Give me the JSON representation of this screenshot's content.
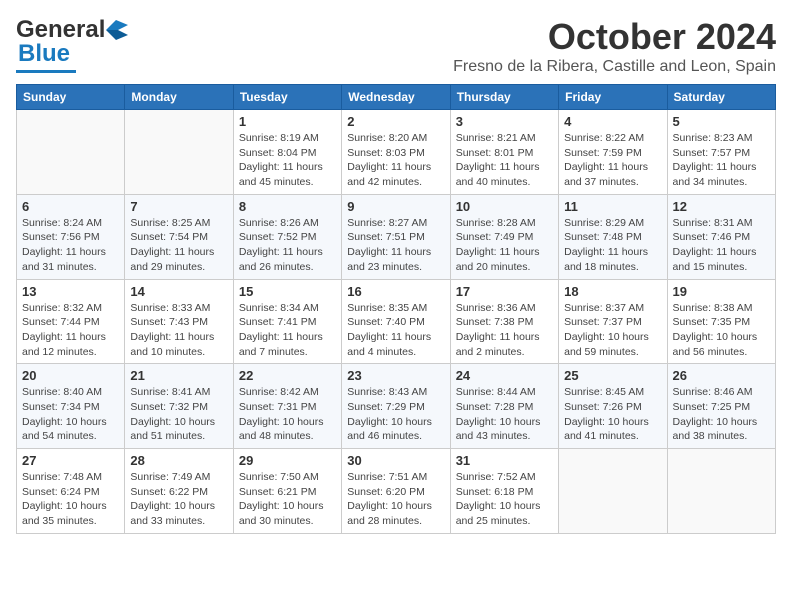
{
  "header": {
    "logo_general": "General",
    "logo_blue": "Blue",
    "month_title": "October 2024",
    "location": "Fresno de la Ribera, Castille and Leon, Spain"
  },
  "weekdays": [
    "Sunday",
    "Monday",
    "Tuesday",
    "Wednesday",
    "Thursday",
    "Friday",
    "Saturday"
  ],
  "weeks": [
    [
      {
        "day": "",
        "info": ""
      },
      {
        "day": "",
        "info": ""
      },
      {
        "day": "1",
        "info": "Sunrise: 8:19 AM\nSunset: 8:04 PM\nDaylight: 11 hours\nand 45 minutes."
      },
      {
        "day": "2",
        "info": "Sunrise: 8:20 AM\nSunset: 8:03 PM\nDaylight: 11 hours\nand 42 minutes."
      },
      {
        "day": "3",
        "info": "Sunrise: 8:21 AM\nSunset: 8:01 PM\nDaylight: 11 hours\nand 40 minutes."
      },
      {
        "day": "4",
        "info": "Sunrise: 8:22 AM\nSunset: 7:59 PM\nDaylight: 11 hours\nand 37 minutes."
      },
      {
        "day": "5",
        "info": "Sunrise: 8:23 AM\nSunset: 7:57 PM\nDaylight: 11 hours\nand 34 minutes."
      }
    ],
    [
      {
        "day": "6",
        "info": "Sunrise: 8:24 AM\nSunset: 7:56 PM\nDaylight: 11 hours\nand 31 minutes."
      },
      {
        "day": "7",
        "info": "Sunrise: 8:25 AM\nSunset: 7:54 PM\nDaylight: 11 hours\nand 29 minutes."
      },
      {
        "day": "8",
        "info": "Sunrise: 8:26 AM\nSunset: 7:52 PM\nDaylight: 11 hours\nand 26 minutes."
      },
      {
        "day": "9",
        "info": "Sunrise: 8:27 AM\nSunset: 7:51 PM\nDaylight: 11 hours\nand 23 minutes."
      },
      {
        "day": "10",
        "info": "Sunrise: 8:28 AM\nSunset: 7:49 PM\nDaylight: 11 hours\nand 20 minutes."
      },
      {
        "day": "11",
        "info": "Sunrise: 8:29 AM\nSunset: 7:48 PM\nDaylight: 11 hours\nand 18 minutes."
      },
      {
        "day": "12",
        "info": "Sunrise: 8:31 AM\nSunset: 7:46 PM\nDaylight: 11 hours\nand 15 minutes."
      }
    ],
    [
      {
        "day": "13",
        "info": "Sunrise: 8:32 AM\nSunset: 7:44 PM\nDaylight: 11 hours\nand 12 minutes."
      },
      {
        "day": "14",
        "info": "Sunrise: 8:33 AM\nSunset: 7:43 PM\nDaylight: 11 hours\nand 10 minutes."
      },
      {
        "day": "15",
        "info": "Sunrise: 8:34 AM\nSunset: 7:41 PM\nDaylight: 11 hours\nand 7 minutes."
      },
      {
        "day": "16",
        "info": "Sunrise: 8:35 AM\nSunset: 7:40 PM\nDaylight: 11 hours\nand 4 minutes."
      },
      {
        "day": "17",
        "info": "Sunrise: 8:36 AM\nSunset: 7:38 PM\nDaylight: 11 hours\nand 2 minutes."
      },
      {
        "day": "18",
        "info": "Sunrise: 8:37 AM\nSunset: 7:37 PM\nDaylight: 10 hours\nand 59 minutes."
      },
      {
        "day": "19",
        "info": "Sunrise: 8:38 AM\nSunset: 7:35 PM\nDaylight: 10 hours\nand 56 minutes."
      }
    ],
    [
      {
        "day": "20",
        "info": "Sunrise: 8:40 AM\nSunset: 7:34 PM\nDaylight: 10 hours\nand 54 minutes."
      },
      {
        "day": "21",
        "info": "Sunrise: 8:41 AM\nSunset: 7:32 PM\nDaylight: 10 hours\nand 51 minutes."
      },
      {
        "day": "22",
        "info": "Sunrise: 8:42 AM\nSunset: 7:31 PM\nDaylight: 10 hours\nand 48 minutes."
      },
      {
        "day": "23",
        "info": "Sunrise: 8:43 AM\nSunset: 7:29 PM\nDaylight: 10 hours\nand 46 minutes."
      },
      {
        "day": "24",
        "info": "Sunrise: 8:44 AM\nSunset: 7:28 PM\nDaylight: 10 hours\nand 43 minutes."
      },
      {
        "day": "25",
        "info": "Sunrise: 8:45 AM\nSunset: 7:26 PM\nDaylight: 10 hours\nand 41 minutes."
      },
      {
        "day": "26",
        "info": "Sunrise: 8:46 AM\nSunset: 7:25 PM\nDaylight: 10 hours\nand 38 minutes."
      }
    ],
    [
      {
        "day": "27",
        "info": "Sunrise: 7:48 AM\nSunset: 6:24 PM\nDaylight: 10 hours\nand 35 minutes."
      },
      {
        "day": "28",
        "info": "Sunrise: 7:49 AM\nSunset: 6:22 PM\nDaylight: 10 hours\nand 33 minutes."
      },
      {
        "day": "29",
        "info": "Sunrise: 7:50 AM\nSunset: 6:21 PM\nDaylight: 10 hours\nand 30 minutes."
      },
      {
        "day": "30",
        "info": "Sunrise: 7:51 AM\nSunset: 6:20 PM\nDaylight: 10 hours\nand 28 minutes."
      },
      {
        "day": "31",
        "info": "Sunrise: 7:52 AM\nSunset: 6:18 PM\nDaylight: 10 hours\nand 25 minutes."
      },
      {
        "day": "",
        "info": ""
      },
      {
        "day": "",
        "info": ""
      }
    ]
  ]
}
